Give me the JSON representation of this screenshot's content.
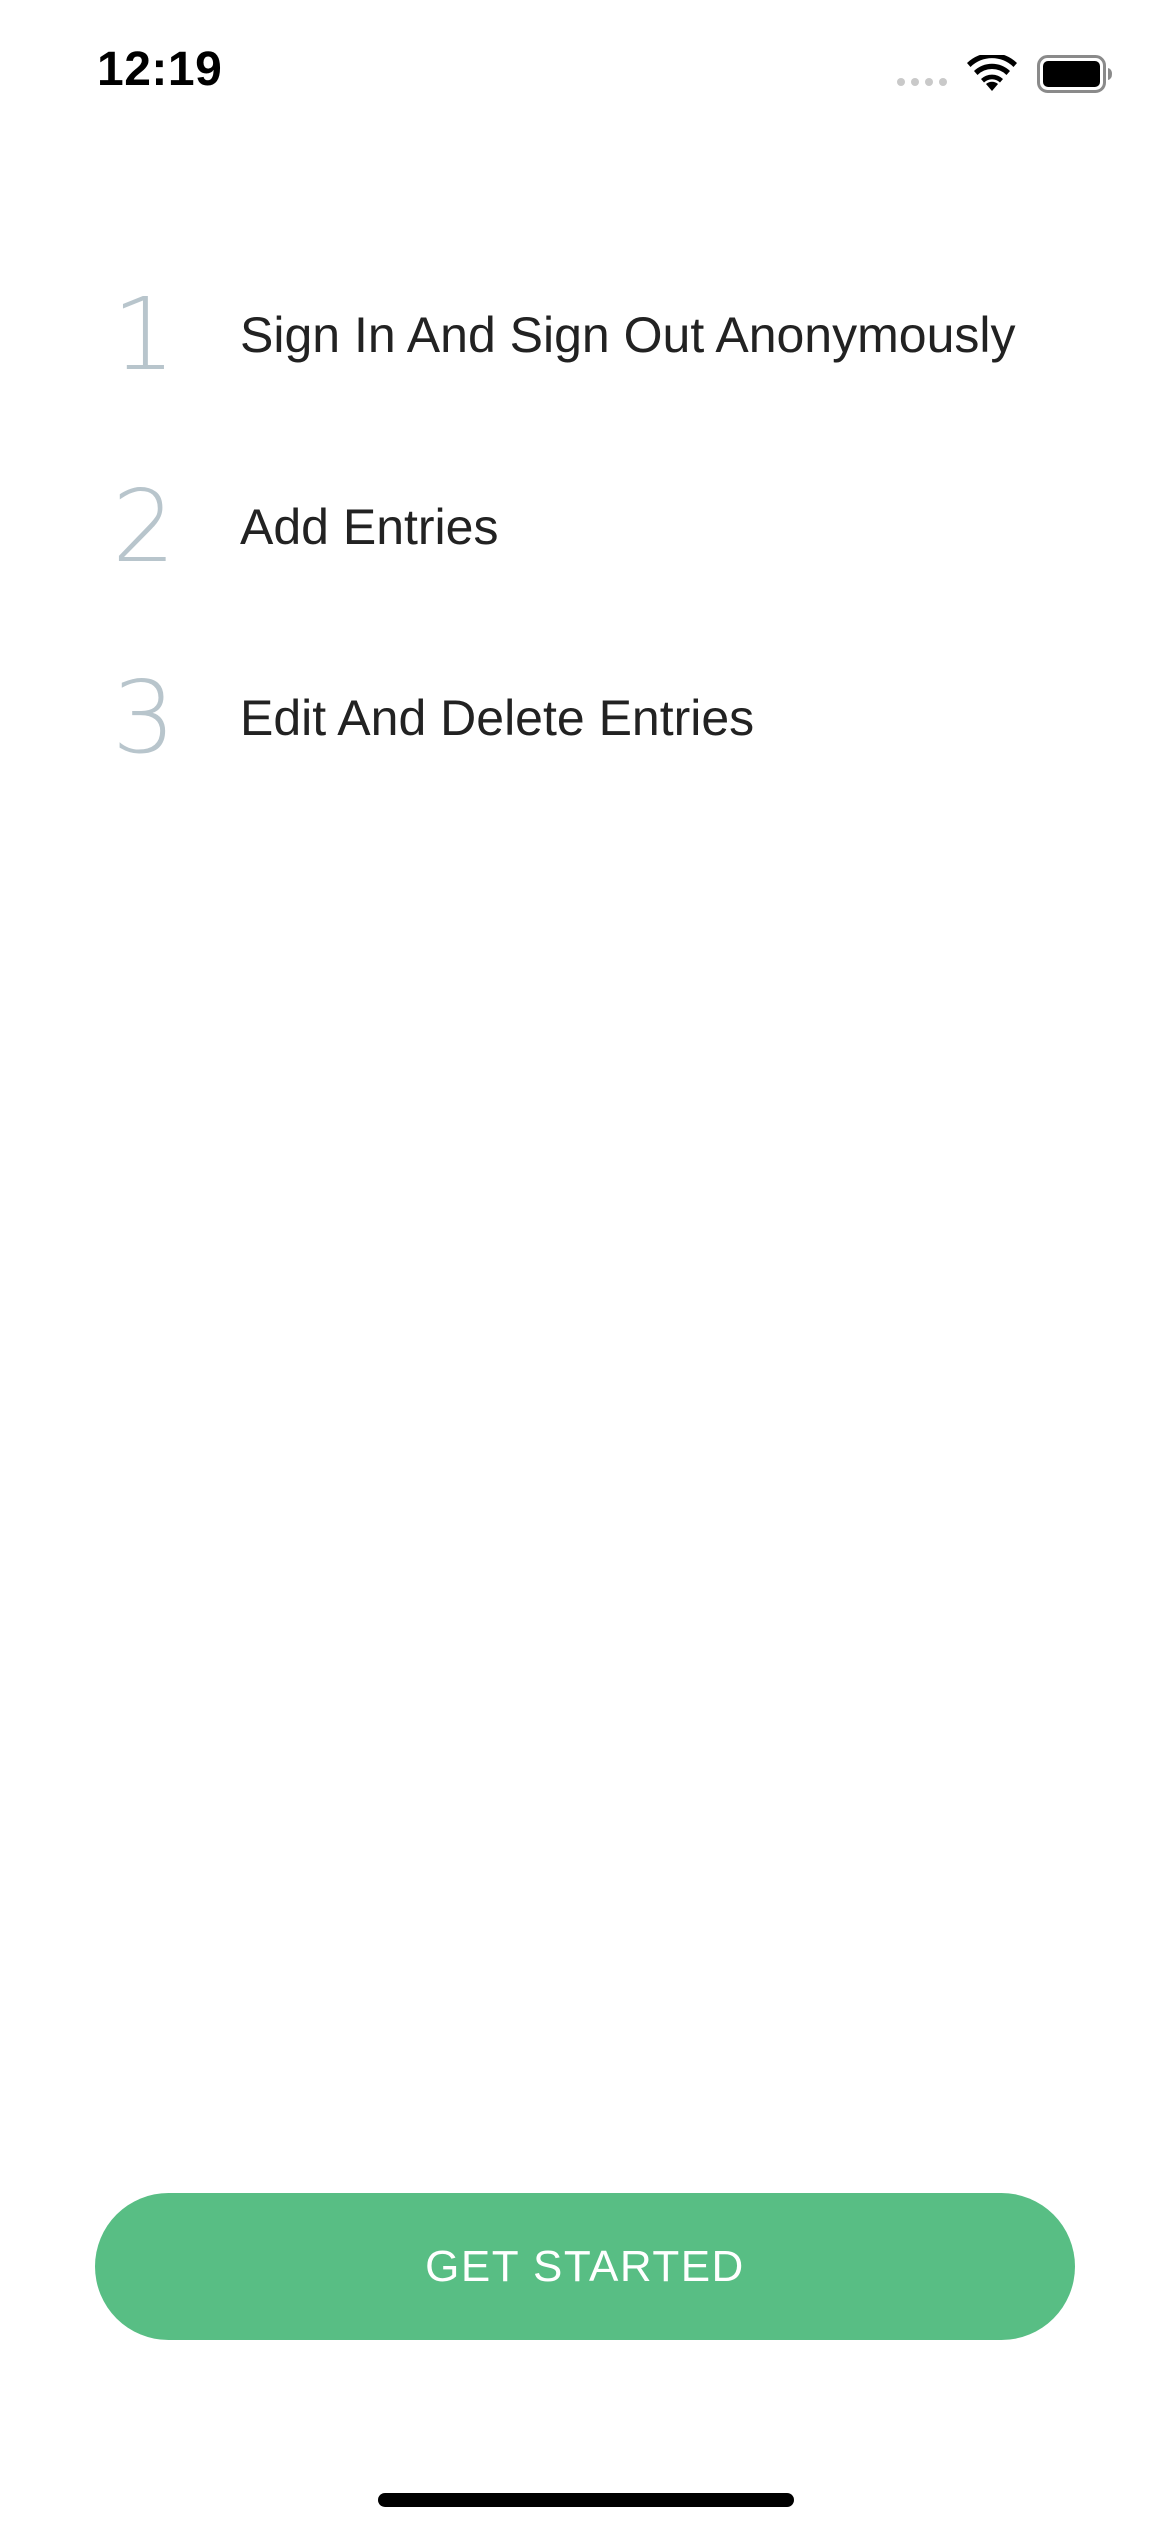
{
  "status_bar": {
    "time": "12:19",
    "icons": [
      "cellular-signal-icon",
      "wifi-icon",
      "battery-icon"
    ]
  },
  "steps": [
    {
      "number": "1",
      "label": "Sign In And Sign Out Anonymously"
    },
    {
      "number": "2",
      "label": "Add Entries"
    },
    {
      "number": "3",
      "label": "Edit And Delete Entries"
    }
  ],
  "cta": {
    "label": "GET STARTED"
  },
  "colors": {
    "accent": "#58be84",
    "step_number": "#b8c5cc",
    "text": "#222222",
    "background": "#ffffff"
  }
}
